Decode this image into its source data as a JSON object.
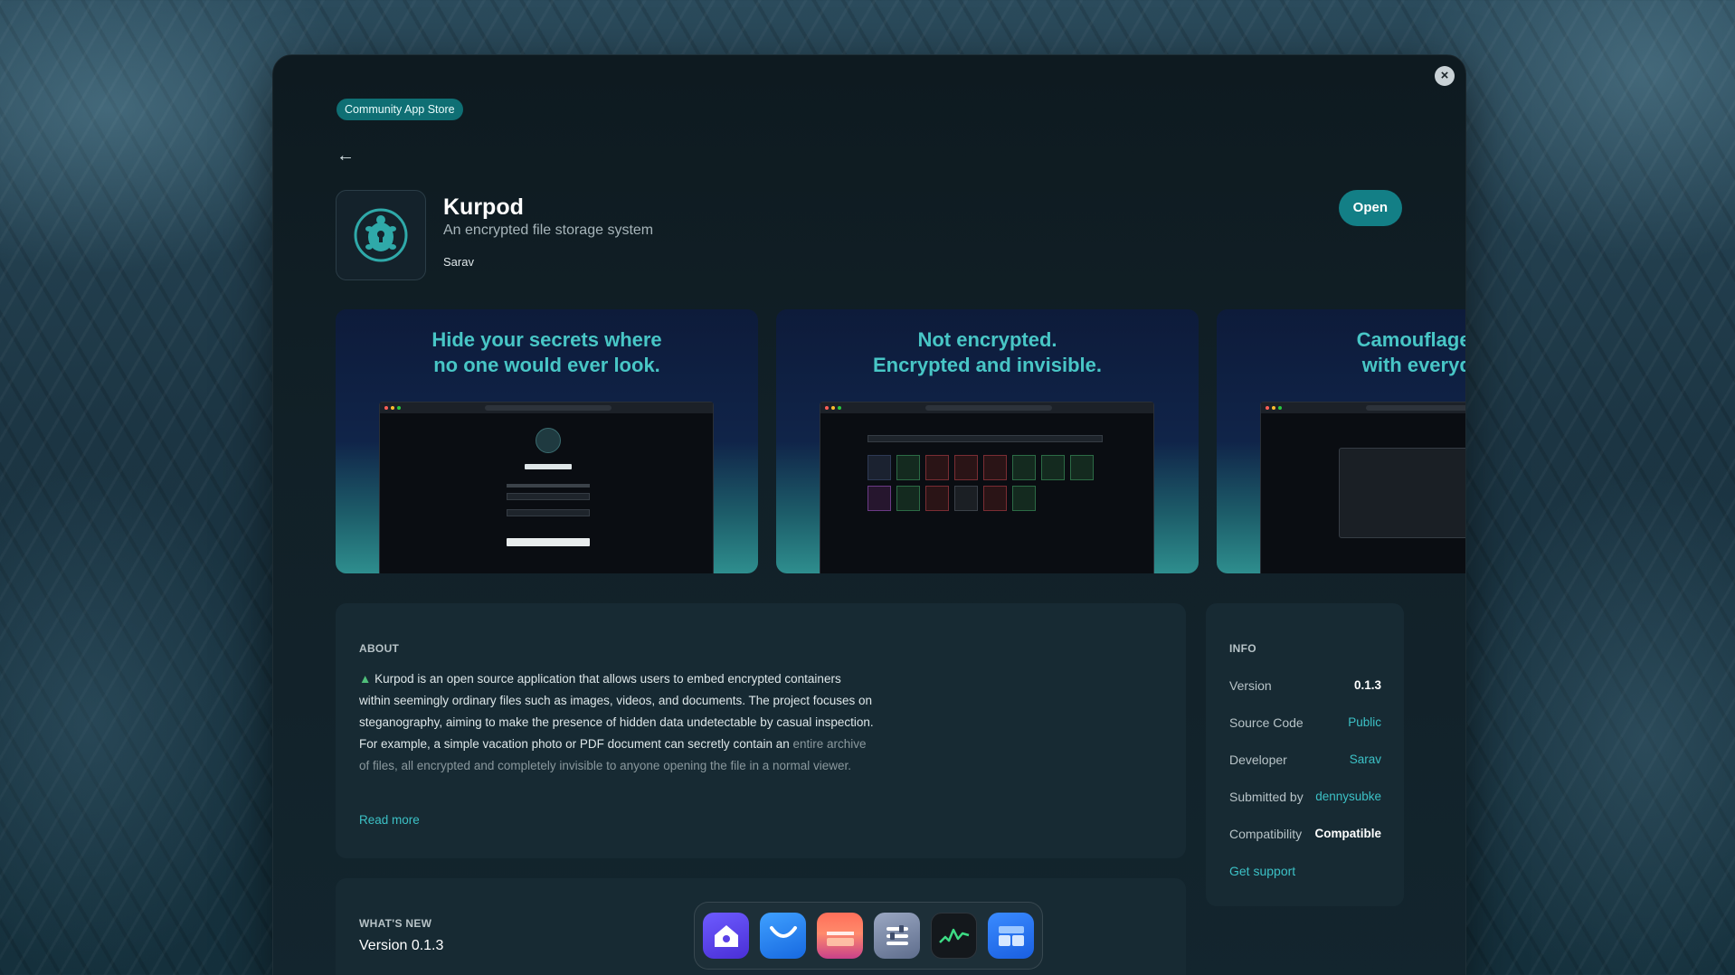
{
  "store": {
    "badge": "Community App Store"
  },
  "app": {
    "name": "Kurpod",
    "tagline": "An encrypted file storage system",
    "developer": "Sarav",
    "open_label": "Open"
  },
  "screenshots": [
    {
      "title": "Hide your secrets where\nno one would ever look."
    },
    {
      "title": "Not encrypted.\nEncrypted and invisible."
    },
    {
      "title": "Camouflage yo\nwith everyday"
    }
  ],
  "about": {
    "label": "ABOUT",
    "text": "Kurpod is an open source application that allows users to embed encrypted containers within seemingly ordinary files such as images, videos, and documents. The project focuses on steganography, aiming to make the presence of hidden data undetectable by casual inspection. For example, a simple vacation photo or PDF document can secretly contain an",
    "text_fade": "entire archive of files, all encrypted and completely invisible to anyone opening the file in a normal viewer.",
    "read_more": "Read more"
  },
  "info": {
    "label": "INFO",
    "rows": [
      {
        "key": "Version",
        "value": "0.1.3"
      },
      {
        "key": "Source Code",
        "value": "Public"
      },
      {
        "key": "Developer",
        "value": "Sarav"
      },
      {
        "key": "Submitted by",
        "value": "dennysubke"
      },
      {
        "key": "Compatibility",
        "value": "Compatible"
      }
    ],
    "support": "Get support"
  },
  "whats_new": {
    "label": "WHAT'S NEW",
    "version": "Version 0.1.3"
  },
  "colors": {
    "accent": "#137f86",
    "link": "#3cc1c6",
    "shot_title": "#48c6c6"
  },
  "dock": [
    "home-app-icon",
    "mail-app-icon",
    "wallet-app-icon",
    "settings-app-icon",
    "activity-monitor-app-icon",
    "files-app-icon"
  ]
}
